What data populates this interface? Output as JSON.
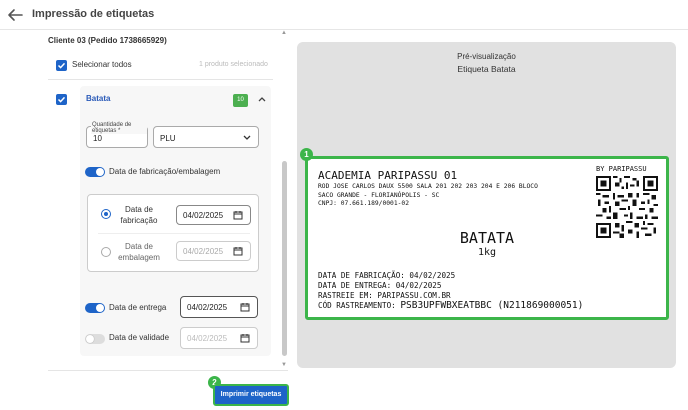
{
  "header": {
    "title": "Impressão de etiquetas"
  },
  "order": {
    "client": "Cliente 03 (Pedido 1738665929)",
    "select_all": "Selecionar todos",
    "selected_count": "1 produto selecionado"
  },
  "product": {
    "name": "Batata",
    "badge": "10",
    "quantity_label": "Quantidade de etiquetas *",
    "quantity_value": "10",
    "unit": "PLU",
    "fab_toggle_label": "Data de fabricação/embalagem",
    "fab_radio_label": "Data de fabricação",
    "fab_date": "04/02/2025",
    "emb_radio_label": "Data de embalagem",
    "emb_date": "04/02/2025",
    "delivery_label": "Data de entrega",
    "delivery_date": "04/02/2025",
    "validity_label": "Data de validade",
    "validity_date": "04/02/2025"
  },
  "toggles": {
    "fabricacao_on": true,
    "entrega_on": true,
    "validade_on": false
  },
  "actions": {
    "print_label": "Imprimir etiquetas"
  },
  "markers": {
    "preview": "1",
    "print": "2"
  },
  "preview": {
    "heading": "Pré-visualização",
    "subheading": "Etiqueta Batata",
    "label": {
      "company": "ACADEMIA PARIPASSU 01",
      "address_1": "ROD JOSE CARLOS DAUX 5500 SALA 201 202 203 204 E 206 BLOCO",
      "address_2": "SACO GRANDE - FLORIANÓPOLIS - SC",
      "cnpj": "CNPJ: 07.661.189/0001-02",
      "brand": "BY PARIPASSU",
      "product": "BATATA",
      "weight": "1kg",
      "fab_line": "DATA DE FABRICAÇÃO: 04/02/2025",
      "entrega_line": "DATA DE ENTREGA: 04/02/2025",
      "rastreie_line": "RASTREIE EM: PARIPASSU.COM.BR",
      "cod_label": "CÓD RASTREAMENTO:",
      "cod_value": "PSB3UPFWBXEATBBC (N211869000051)"
    }
  },
  "colors": {
    "primary": "#1e64c8",
    "highlight": "#3cb54a",
    "badge": "#4caf50"
  },
  "icons": [
    "arrow-left-icon",
    "checkbox-checked-icon",
    "chevron-up-icon",
    "chevron-down-icon",
    "calendar-icon",
    "qr-code"
  ]
}
